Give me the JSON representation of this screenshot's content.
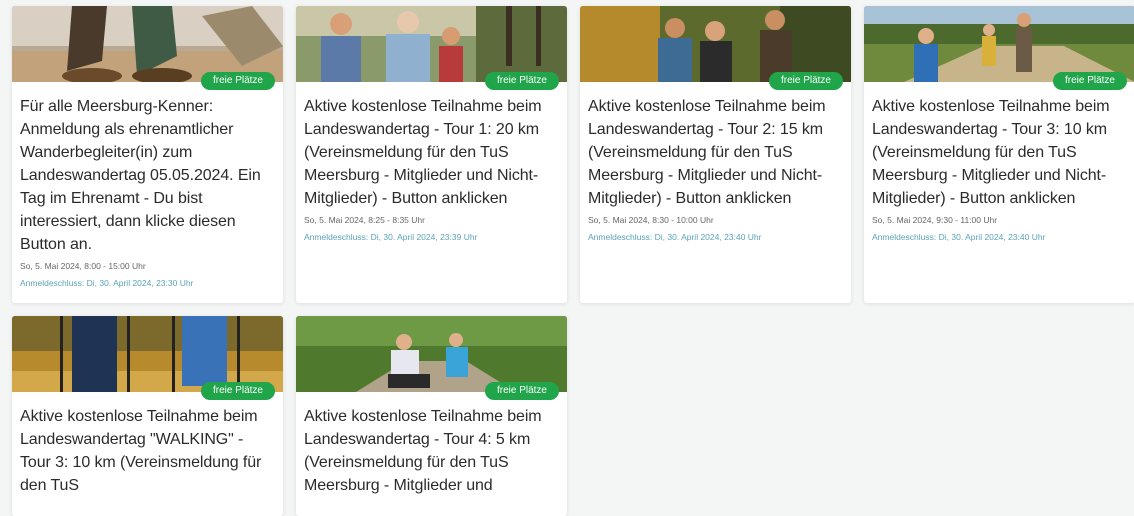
{
  "badge_label": "freie Plätze",
  "colors": {
    "badge": "#21a54a",
    "deadline_text": "#5aa3b8"
  },
  "cards": [
    {
      "image_icon": "hiking-boots-photo",
      "title": "Für alle Meersburg-Kenner: Anmeldung als ehrenamtlicher Wanderbegleiter(in) zum Landeswandertag 05.05.2024. Ein Tag im Ehrenamt - Du bist interessiert, dann klicke diesen Button an.",
      "date": "So, 5. Mai 2024, 8:00 - 15:00 Uhr",
      "deadline": "Anmeldeschluss: Di, 30. April 2024, 23:30 Uhr"
    },
    {
      "image_icon": "hiking-group-photo",
      "title": "Aktive kostenlose Teilnahme beim Landeswandertag - Tour 1: 20 km (Vereinsmeldung für den TuS Meersburg - Mitglieder und Nicht-Mitglieder) - Button anklicken",
      "date": "So, 5. Mai 2024, 8:25 - 8:35 Uhr",
      "deadline": "Anmeldeschluss: Di, 30. April 2024, 23:39 Uhr"
    },
    {
      "image_icon": "forest-hikers-photo",
      "title": "Aktive kostenlose Teilnahme beim Landeswandertag - Tour 2: 15 km (Vereinsmeldung für den TuS Meersburg - Mitglieder und Nicht-Mitglieder) - Button anklicken",
      "date": "So, 5. Mai 2024, 8:30 - 10:00 Uhr",
      "deadline": "Anmeldeschluss: Di, 30. April 2024, 23:40 Uhr"
    },
    {
      "image_icon": "family-trail-photo",
      "title": "Aktive kostenlose Teilnahme beim Landeswandertag - Tour 3: 10 km (Vereinsmeldung für den TuS Meersburg - Mitglieder und Nicht-Mitglieder) - Button anklicken",
      "date": "So, 5. Mai 2024, 9:30 - 11:00 Uhr",
      "deadline": "Anmeldeschluss: Di, 30. April 2024, 23:40 Uhr"
    },
    {
      "image_icon": "nordic-walking-photo",
      "title": "Aktive kostenlose Teilnahme beim Landeswandertag \"WALKING\" - Tour 3: 10 km (Vereinsmeldung für den TuS",
      "date": "",
      "deadline": ""
    },
    {
      "image_icon": "stroller-walk-photo",
      "title": "Aktive kostenlose Teilnahme beim Landeswandertag - Tour 4: 5 km (Vereinsmeldung für den TuS Meersburg - Mitglieder und",
      "date": "",
      "deadline": ""
    }
  ]
}
